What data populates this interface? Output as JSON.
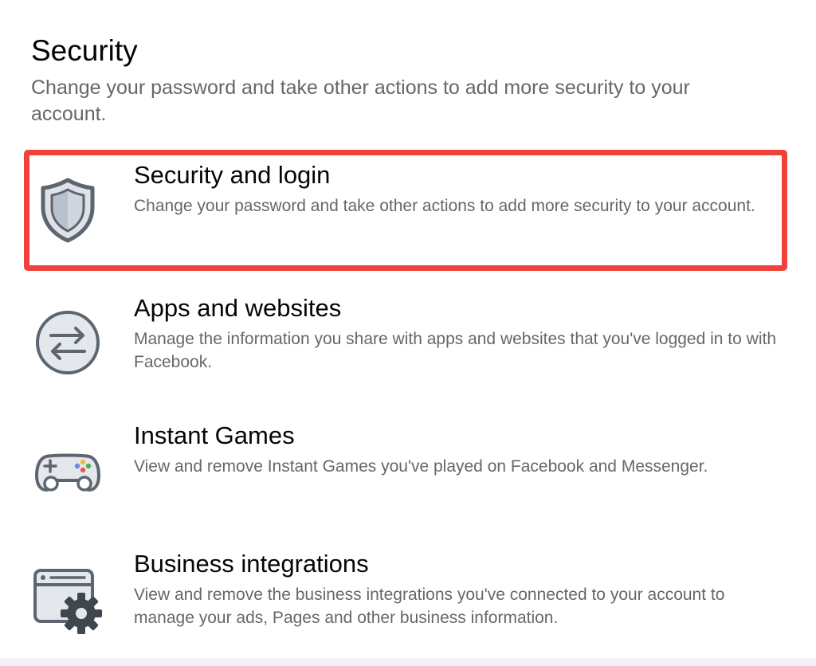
{
  "section": {
    "title": "Security",
    "description": "Change your password and take other actions to add more security to your account."
  },
  "items": [
    {
      "title": "Security and login",
      "description": "Change your password and take other actions to add more security to your account.",
      "icon": "shield-icon",
      "selected": true
    },
    {
      "title": "Apps and websites",
      "description": "Manage the information you share with apps and websites that you've logged in to with Facebook.",
      "icon": "swap-arrows-icon",
      "selected": false
    },
    {
      "title": "Instant Games",
      "description": "View and remove Instant Games you've played on Facebook and Messenger.",
      "icon": "gamepad-icon",
      "selected": false
    },
    {
      "title": "Business integrations",
      "description": "View and remove the business integrations you've connected to your account to manage your ads, Pages and other business information.",
      "icon": "browser-gear-icon",
      "selected": false
    }
  ],
  "colors": {
    "highlight": "#f0413a",
    "icon_fill": "#dfe3e8",
    "icon_stroke": "#5d6670"
  }
}
